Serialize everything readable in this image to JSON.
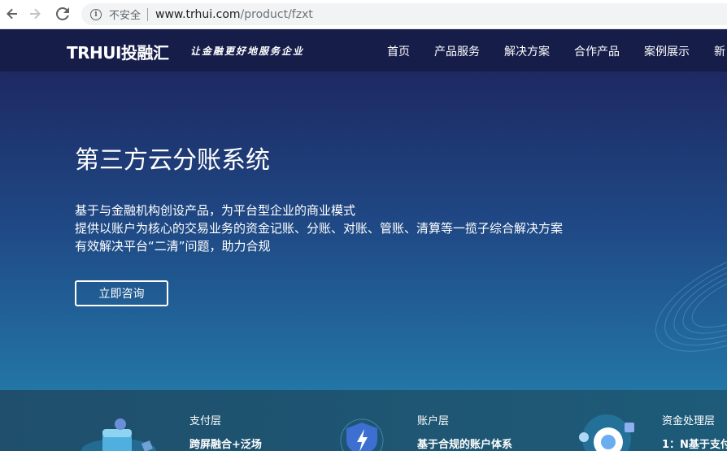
{
  "browser": {
    "security_label": "不安全",
    "url_host": "www.trhui.com",
    "url_path": "/product/fzxt",
    "icons": [
      "back-arrow-icon",
      "forward-arrow-icon",
      "reload-icon",
      "info-icon"
    ]
  },
  "site": {
    "logo": "TRHUI投融汇",
    "slogan": "让金融更好地服务企业",
    "menu": [
      "首页",
      "产品服务",
      "解决方案",
      "合作产品",
      "案例展示",
      "新"
    ]
  },
  "hero": {
    "title": "第三方云分账系统",
    "desc_lines": [
      "基于与金融机构创设产品，为平台型企业的商业模式",
      "提供以账户为核心的交易业务的资金记账、分账、对账、管账、清算等一揽子综合解决方案",
      "有效解决平台“二清”问题，助力合规"
    ],
    "button": "立即咨询"
  },
  "layers": [
    {
      "title": "支付层",
      "sub": "跨屏融合+泛场"
    },
    {
      "title": "账户层",
      "sub": "基于合规的账户体系"
    },
    {
      "title": "资金处理层",
      "sub": "1：N基于支付"
    }
  ],
  "colors": {
    "nav_bg": "#161d49",
    "hero_top": "#1e2963",
    "hero_bottom": "#2376a6"
  }
}
